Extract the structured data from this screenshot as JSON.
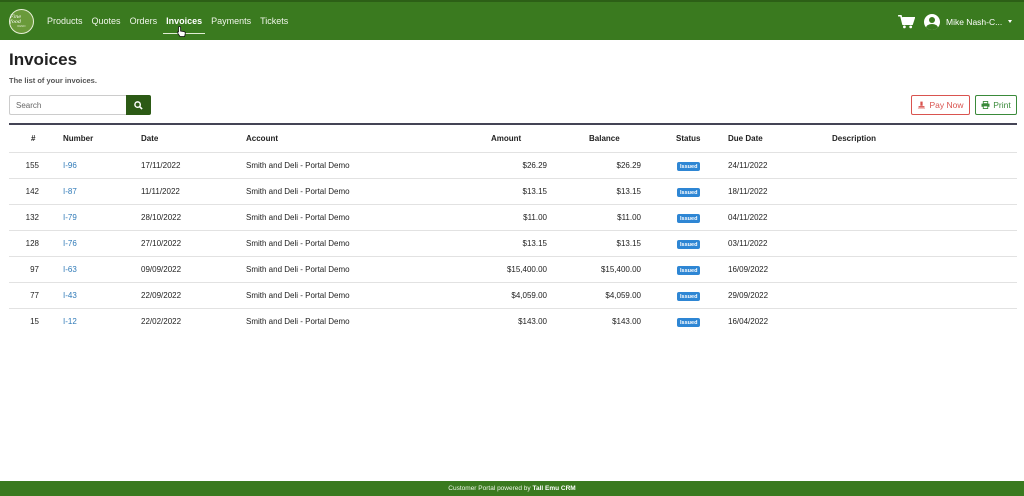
{
  "navbar": {
    "logo": {
      "line1": "Fine food",
      "line2": "DEMO"
    },
    "items": [
      {
        "label": "Products",
        "active": false
      },
      {
        "label": "Quotes",
        "active": false
      },
      {
        "label": "Orders",
        "active": false
      },
      {
        "label": "Invoices",
        "active": true
      },
      {
        "label": "Payments",
        "active": false
      },
      {
        "label": "Tickets",
        "active": false
      }
    ],
    "user_name": "Mike Nash-C...",
    "icons": [
      "cart-icon",
      "user-icon",
      "caret-down-icon"
    ],
    "bg_color": "#3a7a1f"
  },
  "page": {
    "title": "Invoices",
    "subtitle": "The list of your invoices."
  },
  "search": {
    "placeholder": "Search",
    "value": ""
  },
  "buttons": {
    "pay_now": "Pay Now",
    "print": "Print"
  },
  "table": {
    "headers": {
      "num": "#",
      "number": "Number",
      "date": "Date",
      "account": "Account",
      "amount": "Amount",
      "balance": "Balance",
      "status": "Status",
      "due_date": "Due Date",
      "description": "Description"
    },
    "rows": [
      {
        "num": "155",
        "number": "I-96",
        "date": "17/11/2022",
        "account": "Smith and Deli - Portal Demo",
        "amount": "$26.29",
        "balance": "$26.29",
        "status": "Issued",
        "due_date": "24/11/2022",
        "description": ""
      },
      {
        "num": "142",
        "number": "I-87",
        "date": "11/11/2022",
        "account": "Smith and Deli - Portal Demo",
        "amount": "$13.15",
        "balance": "$13.15",
        "status": "Issued",
        "due_date": "18/11/2022",
        "description": ""
      },
      {
        "num": "132",
        "number": "I-79",
        "date": "28/10/2022",
        "account": "Smith and Deli - Portal Demo",
        "amount": "$11.00",
        "balance": "$11.00",
        "status": "Issued",
        "due_date": "04/11/2022",
        "description": ""
      },
      {
        "num": "128",
        "number": "I-76",
        "date": "27/10/2022",
        "account": "Smith and Deli - Portal Demo",
        "amount": "$13.15",
        "balance": "$13.15",
        "status": "Issued",
        "due_date": "03/11/2022",
        "description": ""
      },
      {
        "num": "97",
        "number": "I-63",
        "date": "09/09/2022",
        "account": "Smith and Deli - Portal Demo",
        "amount": "$15,400.00",
        "balance": "$15,400.00",
        "status": "Issued",
        "due_date": "16/09/2022",
        "description": ""
      },
      {
        "num": "77",
        "number": "I-43",
        "date": "22/09/2022",
        "account": "Smith and Deli - Portal Demo",
        "amount": "$4,059.00",
        "balance": "$4,059.00",
        "status": "Issued",
        "due_date": "29/09/2022",
        "description": ""
      },
      {
        "num": "15",
        "number": "I-12",
        "date": "22/02/2022",
        "account": "Smith and Deli - Portal Demo",
        "amount": "$143.00",
        "balance": "$143.00",
        "status": "Issued",
        "due_date": "16/04/2022",
        "description": ""
      }
    ]
  },
  "footer": {
    "prefix": "Customer Portal powered by ",
    "brand": "Tall Emu CRM"
  },
  "colors": {
    "primary": "#3a7a1f",
    "pay_now": "#d9534f",
    "print": "#3a8a3a",
    "link": "#2f7ab8",
    "badge": "#2e86d4"
  }
}
